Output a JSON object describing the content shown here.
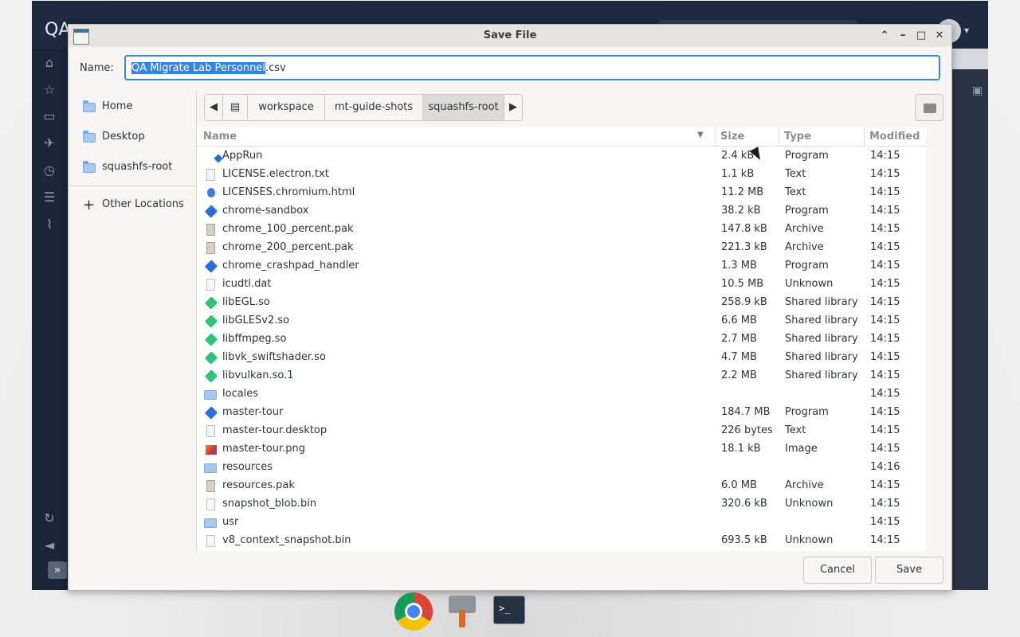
{
  "app": {
    "title": "QA"
  },
  "dialog": {
    "title": "Save File",
    "controls": {
      "restore": "⌃",
      "minimize": "–",
      "maximize": "□",
      "close": "✕"
    },
    "name_label": "Name:",
    "filename_selected": "QA Migrate Lab Personnel",
    "filename_ext": ".csv",
    "places": [
      {
        "label": "Home",
        "icon": "home-folder-icon"
      },
      {
        "label": "Desktop",
        "icon": "desktop-folder-icon"
      },
      {
        "label": "squashfs-root",
        "icon": "folder-icon"
      }
    ],
    "other_locations": "Other Locations",
    "path": [
      "workspace",
      "mt-guide-shots",
      "squashfs-root"
    ],
    "columns": {
      "name": "Name",
      "size": "Size",
      "type": "Type",
      "modified": "Modified"
    },
    "files": [
      {
        "name": "AppRun",
        "size": "2.4 kB",
        "type": "Program",
        "modified": "14:15",
        "icon": "program-icon"
      },
      {
        "name": "LICENSE.electron.txt",
        "size": "1.1 kB",
        "type": "Text",
        "modified": "14:15",
        "icon": "text-icon"
      },
      {
        "name": "LICENSES.chromium.html",
        "size": "11.2 MB",
        "type": "Text",
        "modified": "14:15",
        "icon": "html-icon"
      },
      {
        "name": "chrome-sandbox",
        "size": "38.2 kB",
        "type": "Program",
        "modified": "14:15",
        "icon": "program-icon"
      },
      {
        "name": "chrome_100_percent.pak",
        "size": "147.8 kB",
        "type": "Archive",
        "modified": "14:15",
        "icon": "archive-icon"
      },
      {
        "name": "chrome_200_percent.pak",
        "size": "221.3 kB",
        "type": "Archive",
        "modified": "14:15",
        "icon": "archive-icon"
      },
      {
        "name": "chrome_crashpad_handler",
        "size": "1.3 MB",
        "type": "Program",
        "modified": "14:15",
        "icon": "program-icon"
      },
      {
        "name": "icudtl.dat",
        "size": "10.5 MB",
        "type": "Unknown",
        "modified": "14:15",
        "icon": "unknown-file-icon"
      },
      {
        "name": "libEGL.so",
        "size": "258.9 kB",
        "type": "Shared library",
        "modified": "14:15",
        "icon": "library-icon"
      },
      {
        "name": "libGLESv2.so",
        "size": "6.6 MB",
        "type": "Shared library",
        "modified": "14:15",
        "icon": "library-icon"
      },
      {
        "name": "libffmpeg.so",
        "size": "2.7 MB",
        "type": "Shared library",
        "modified": "14:15",
        "icon": "library-icon"
      },
      {
        "name": "libvk_swiftshader.so",
        "size": "4.7 MB",
        "type": "Shared library",
        "modified": "14:15",
        "icon": "library-icon"
      },
      {
        "name": "libvulkan.so.1",
        "size": "2.2 MB",
        "type": "Shared library",
        "modified": "14:15",
        "icon": "library-icon"
      },
      {
        "name": "locales",
        "size": "",
        "type": "",
        "modified": "14:15",
        "icon": "folder-icon"
      },
      {
        "name": "master-tour",
        "size": "184.7 MB",
        "type": "Program",
        "modified": "14:15",
        "icon": "program-icon"
      },
      {
        "name": "master-tour.desktop",
        "size": "226 bytes",
        "type": "Text",
        "modified": "14:15",
        "icon": "text-icon"
      },
      {
        "name": "master-tour.png",
        "size": "18.1 kB",
        "type": "Image",
        "modified": "14:15",
        "icon": "image-icon"
      },
      {
        "name": "resources",
        "size": "",
        "type": "",
        "modified": "14:16",
        "icon": "folder-icon"
      },
      {
        "name": "resources.pak",
        "size": "6.0 MB",
        "type": "Archive",
        "modified": "14:15",
        "icon": "archive-icon"
      },
      {
        "name": "snapshot_blob.bin",
        "size": "320.6 kB",
        "type": "Unknown",
        "modified": "14:15",
        "icon": "unknown-file-icon"
      },
      {
        "name": "usr",
        "size": "",
        "type": "",
        "modified": "14:15",
        "icon": "folder-icon"
      },
      {
        "name": "v8_context_snapshot.bin",
        "size": "693.5 kB",
        "type": "Unknown",
        "modified": "14:15",
        "icon": "unknown-file-icon"
      }
    ],
    "cancel_label": "Cancel",
    "save_label": "Save"
  },
  "dock": [
    {
      "name": "chrome-icon"
    },
    {
      "name": "settings-tool-icon"
    },
    {
      "name": "terminal-icon",
      "label": ">_"
    }
  ],
  "colors": {
    "accent": "#3584e4",
    "app_header": "#1d2a40",
    "dialog_bg": "#f6f5f4"
  }
}
